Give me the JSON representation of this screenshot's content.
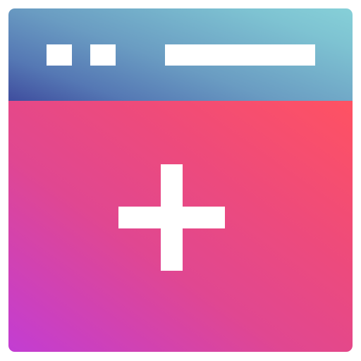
{
  "icon": {
    "name": "add-window-icon",
    "colors": {
      "titlebar_start": "#86d0d8",
      "titlebar_end": "#3f4d9e",
      "content_start": "#ff5262",
      "content_end": "#c23dd3",
      "foreground": "#ffffff"
    }
  }
}
